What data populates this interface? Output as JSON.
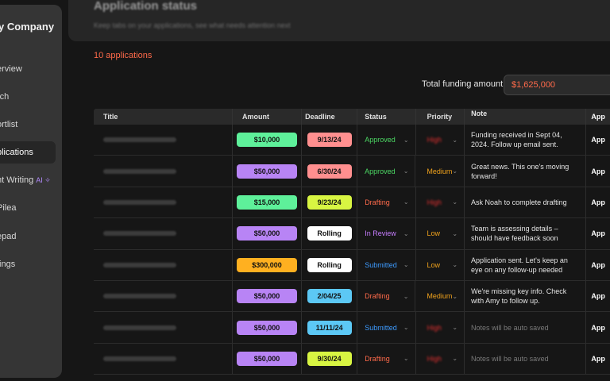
{
  "sidebar": {
    "brand": "y Company",
    "items": [
      {
        "label": "erview",
        "active": false,
        "ai": false
      },
      {
        "label": "rch",
        "active": false,
        "ai": false
      },
      {
        "label": "ortlist",
        "active": false,
        "ai": false
      },
      {
        "label": "plications",
        "active": true,
        "ai": false
      },
      {
        "label": "nt Writing",
        "active": false,
        "ai": true,
        "badge": "AI ✧"
      },
      {
        "label": "Pilea",
        "active": false,
        "ai": false
      },
      {
        "label": "epad",
        "active": false,
        "ai": false
      },
      {
        "label": "tings",
        "active": false,
        "ai": false
      }
    ]
  },
  "header": {
    "title": "Application status",
    "subtitle": "Keep tabs on your applications, see what needs attention next"
  },
  "summary": {
    "count_text": "10 applications",
    "funding_label": "Total funding amount:",
    "funding_value": "$1,625,000"
  },
  "table": {
    "columns": [
      "Title",
      "Amount",
      "Deadline",
      "Status",
      "Priority",
      "Note",
      "App"
    ],
    "rows": [
      {
        "amount": "$10,000",
        "amount_color": "#5ef09a",
        "deadline": "9/13/24",
        "deadline_color": "#ff8f8f",
        "status": "Approved",
        "status_color": "#4cd964",
        "priority": "High",
        "priority_color": "#e03030",
        "priority_blurred": true,
        "note": "Funding received in Sept 04, 2024. Follow up email sent.",
        "note_muted": false,
        "app": "App"
      },
      {
        "amount": "$50,000",
        "amount_color": "#b884f5",
        "deadline": "6/30/24",
        "deadline_color": "#ff8f8f",
        "status": "Approved",
        "status_color": "#4cd964",
        "priority": "Medium",
        "priority_color": "#f0a21c",
        "priority_blurred": false,
        "note": "Great news. This one's moving forward!",
        "note_muted": false,
        "app": "App"
      },
      {
        "amount": "$15,000",
        "amount_color": "#5ef09a",
        "deadline": "9/23/24",
        "deadline_color": "#d8f542",
        "status": "Drafting",
        "status_color": "#ff6a4a",
        "priority": "High",
        "priority_color": "#e03030",
        "priority_blurred": true,
        "note": "Ask Noah to complete drafting",
        "note_muted": false,
        "app": "App"
      },
      {
        "amount": "$50,000",
        "amount_color": "#b884f5",
        "deadline": "Rolling",
        "deadline_color": "#ffffff",
        "status": "In Review",
        "status_color": "#c77dff",
        "priority": "Low",
        "priority_color": "#f0a21c",
        "priority_blurred": false,
        "note": "Team is assessing details – should have feedback soon",
        "note_muted": false,
        "app": "App"
      },
      {
        "amount": "$300,000",
        "amount_color": "#ffb020",
        "deadline": "Rolling",
        "deadline_color": "#ffffff",
        "status": "Submitted",
        "status_color": "#3d9bff",
        "priority": "Low",
        "priority_color": "#f0a21c",
        "priority_blurred": false,
        "note": "Application sent. Let's keep an eye on any follow-up needed",
        "note_muted": false,
        "app": "App"
      },
      {
        "amount": "$50,000",
        "amount_color": "#b884f5",
        "deadline": "2/04/25",
        "deadline_color": "#5cc8f5",
        "status": "Drafting",
        "status_color": "#ff6a4a",
        "priority": "Medium",
        "priority_color": "#f0a21c",
        "priority_blurred": false,
        "note": "We're missing key info. Check with Amy to follow up.",
        "note_muted": false,
        "app": "App"
      },
      {
        "amount": "$50,000",
        "amount_color": "#b884f5",
        "deadline": "11/11/24",
        "deadline_color": "#5cc8f5",
        "status": "Submitted",
        "status_color": "#3d9bff",
        "priority": "High",
        "priority_color": "#e03030",
        "priority_blurred": true,
        "note": "Notes will be auto saved",
        "note_muted": true,
        "app": "App"
      },
      {
        "amount": "$50,000",
        "amount_color": "#b884f5",
        "deadline": "9/30/24",
        "deadline_color": "#d8f542",
        "status": "Drafting",
        "status_color": "#ff6a4a",
        "priority": "High",
        "priority_color": "#e03030",
        "priority_blurred": true,
        "note": "Notes will be auto saved",
        "note_muted": true,
        "app": "App"
      }
    ]
  },
  "icons": {
    "dropdown": "chevron-down-icon",
    "ai": "sparkle-icon"
  }
}
